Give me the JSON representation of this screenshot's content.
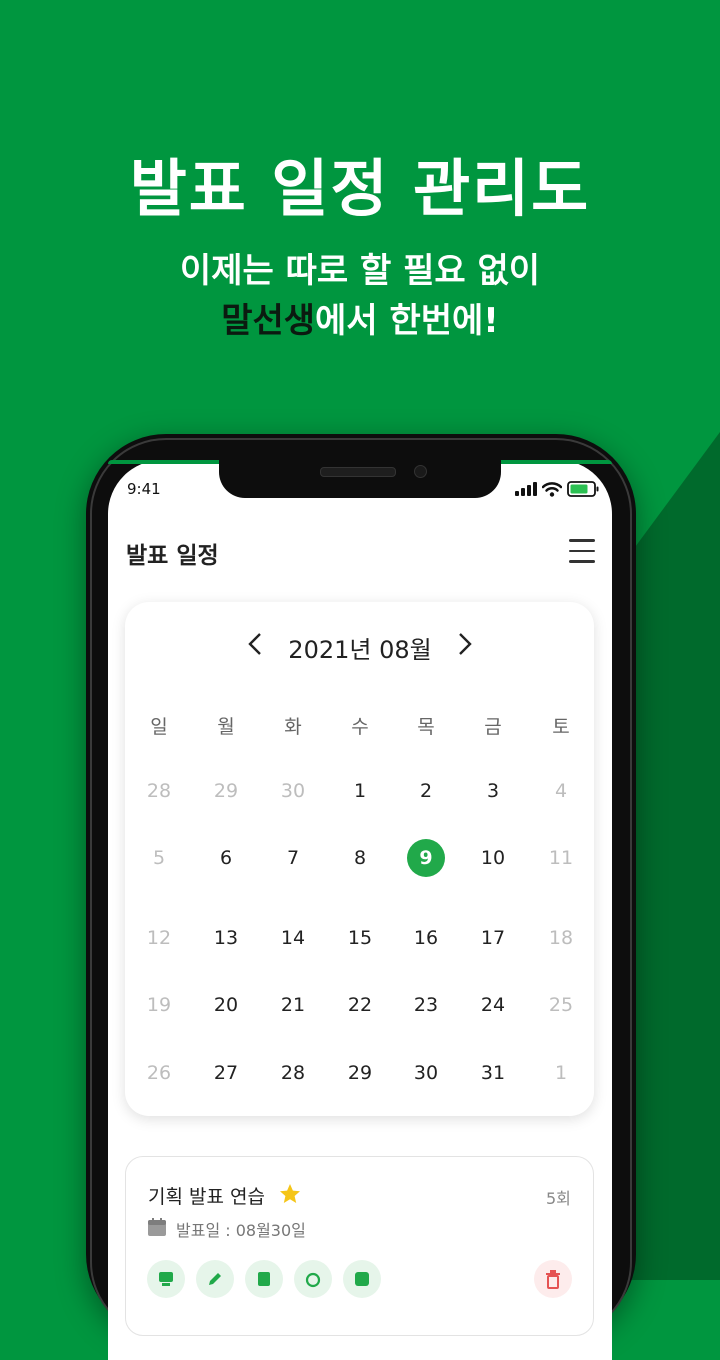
{
  "promo": {
    "headline": "발표 일정 관리도",
    "subline1": "이제는 따로 할 필요 없이",
    "brand": "말선생",
    "subline2_rest": "에서 한번에!"
  },
  "colors": {
    "brand_green": "#00963f",
    "dark_green": "#006a2c",
    "today": "#21a94a"
  },
  "status_bar": {
    "time": "9:41"
  },
  "app": {
    "title": "발표 일정",
    "menu_icon": "hamburger-icon"
  },
  "calendar": {
    "prev_icon": "chevron-left-icon",
    "next_icon": "chevron-right-icon",
    "month_label": "2021년 08월",
    "weekdays": [
      "일",
      "월",
      "화",
      "수",
      "목",
      "금",
      "토"
    ],
    "weeks": [
      [
        "28",
        "29",
        "30",
        "1",
        "2",
        "3",
        "4"
      ],
      [
        "5",
        "6",
        "7",
        "8",
        "9",
        "10",
        "11"
      ],
      [
        "12",
        "13",
        "14",
        "15",
        "16",
        "17",
        "18"
      ],
      [
        "19",
        "20",
        "21",
        "22",
        "23",
        "24",
        "25"
      ],
      [
        "26",
        "27",
        "28",
        "29",
        "30",
        "31",
        "1"
      ]
    ],
    "selected_day": "9"
  },
  "schedule_card": {
    "title": "기획 발표 연습",
    "favorite_icon": "star-icon",
    "count": "5회",
    "date_label": "발표일 : 08월30일"
  }
}
